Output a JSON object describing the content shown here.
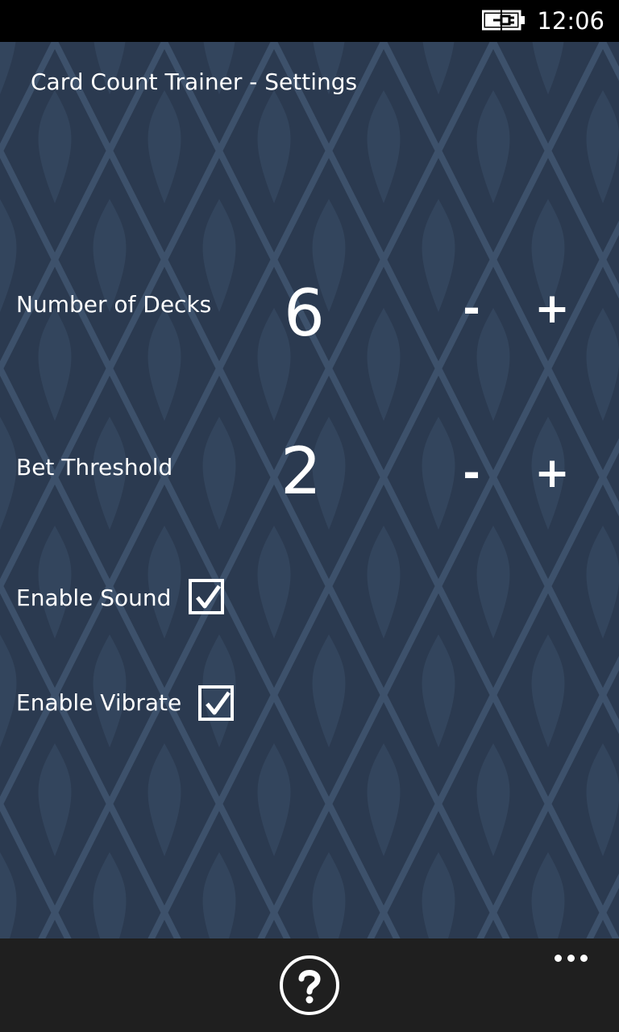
{
  "status_bar": {
    "time": "12:06",
    "battery_icon": "battery-charging-icon"
  },
  "page": {
    "title": "Card Count Trainer - Settings"
  },
  "settings": {
    "decks": {
      "label": "Number of Decks",
      "value": "6",
      "minus_label": "-",
      "plus_label": "+"
    },
    "bet_threshold": {
      "label": "Bet Threshold",
      "value": "2",
      "minus_label": "-",
      "plus_label": "+"
    },
    "enable_sound": {
      "label": "Enable Sound",
      "checked": true
    },
    "enable_vibrate": {
      "label": "Enable Vibrate",
      "checked": true
    }
  },
  "app_bar": {
    "help_icon": "question-circle-icon",
    "more_icon": "ellipsis-icon"
  },
  "colors": {
    "background": "#2b3a50",
    "pattern": "#364a63",
    "status_bar": "#000000",
    "app_bar": "#1f1f1f",
    "text": "#ffffff"
  }
}
